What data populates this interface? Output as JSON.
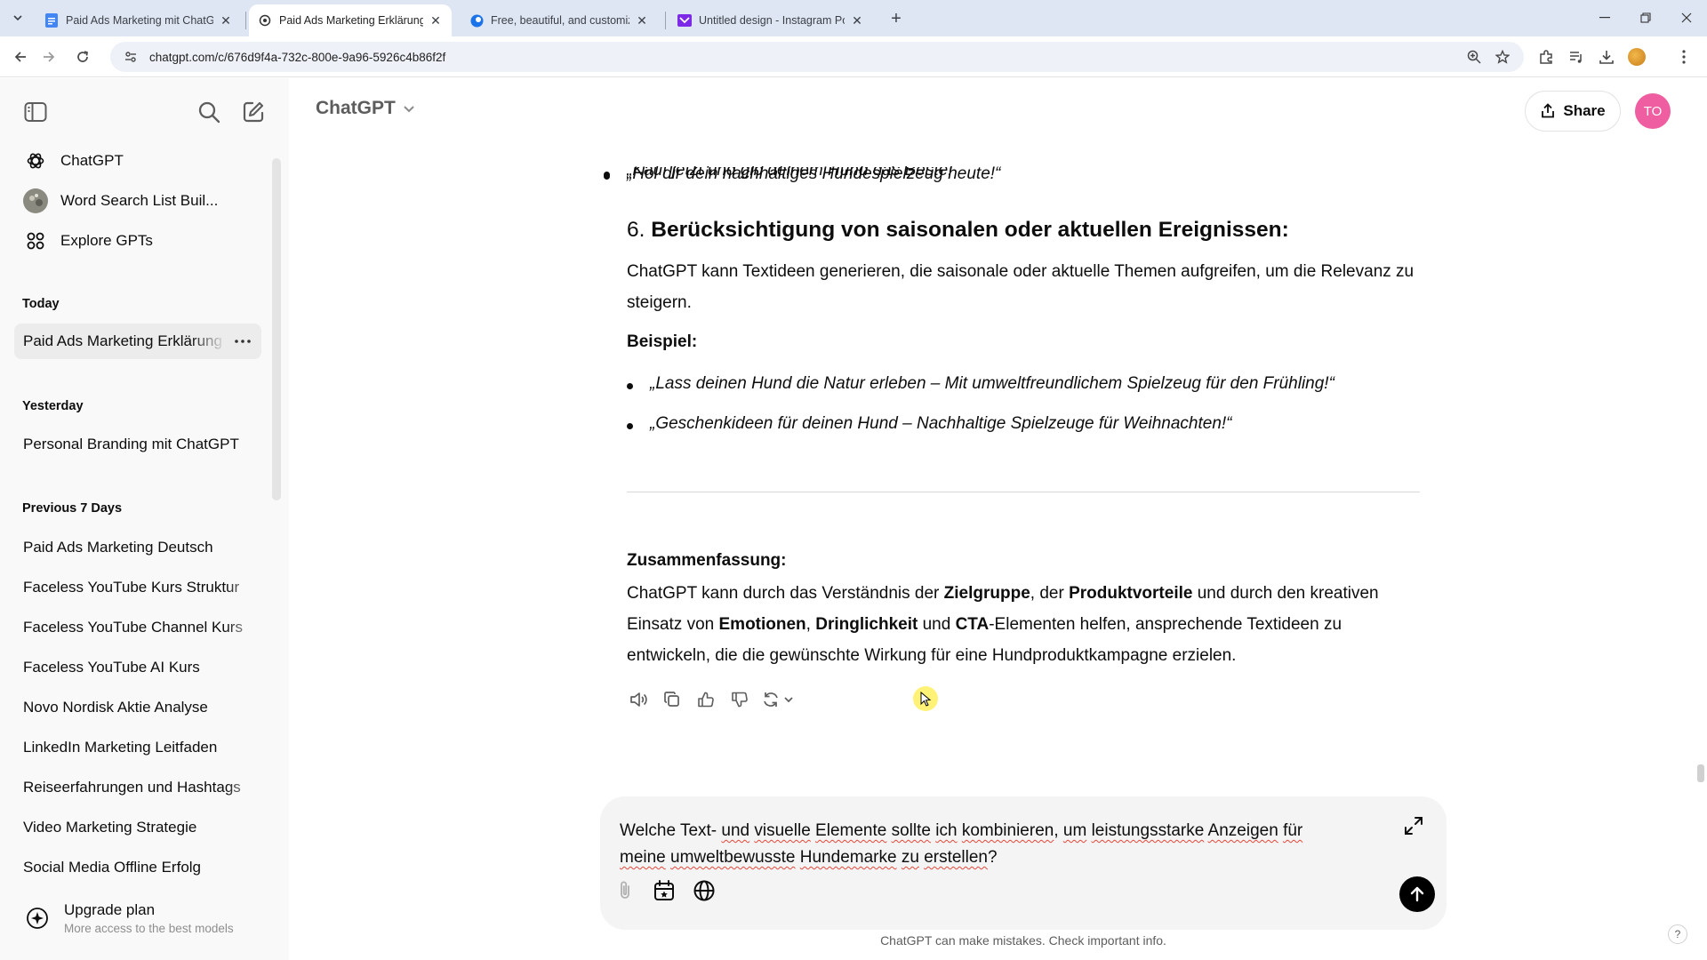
{
  "browser": {
    "tabs": [
      {
        "title": "Paid Ads Marketing mit ChatGPT",
        "active": false
      },
      {
        "title": "Paid Ads Marketing Erklärung",
        "active": true
      },
      {
        "title": "Free, beautiful, and customizable",
        "active": false
      },
      {
        "title": "Untitled design - Instagram Post",
        "active": false
      }
    ],
    "url": "chatgpt.com/c/676d9f4a-732c-800e-9a96-5926c4b86f2f"
  },
  "sidebar": {
    "nav": [
      {
        "label": "ChatGPT",
        "icon": "openai-logo-icon"
      },
      {
        "label": "Word Search List Buil...",
        "icon": "gpt-avatar-icon"
      },
      {
        "label": "Explore GPTs",
        "icon": "grid-icon"
      }
    ],
    "sections": [
      {
        "title": "Today",
        "items": [
          "Paid Ads Marketing Erklärung"
        ]
      },
      {
        "title": "Yesterday",
        "items": [
          "Personal Branding mit ChatGPT"
        ]
      },
      {
        "title": "Previous 7 Days",
        "items": [
          "Paid Ads Marketing Deutsch",
          "Faceless YouTube Kurs Struktur",
          "Faceless YouTube Channel Kurs",
          "Faceless YouTube AI Kurs",
          "Novo Nordisk Aktie Analyse",
          "LinkedIn Marketing Leitfaden",
          "Reiseerfahrungen und Hashtags",
          "Video Marketing Strategie",
          "Social Media Offline Erfolg"
        ]
      }
    ],
    "upgrade": {
      "title": "Upgrade plan",
      "subtitle": "More access to the best models"
    }
  },
  "header": {
    "model": "ChatGPT",
    "share_label": "Share",
    "avatar_initials": "TO"
  },
  "message": {
    "clipped_line": "„Kauf jetzt und gib deinem Hund das Beste!“",
    "bullet_top": "„Hol dir dein nachhaltiges Hundespielzeug heute!“",
    "heading_num": "6.",
    "heading_text": "Berücksichtigung von saisonalen oder aktuellen Ereignissen:",
    "para1": "ChatGPT kann Textideen generieren, die saisonale oder aktuelle Themen aufgreifen, um die Relevanz zu steigern.",
    "example_label": "Beispiel:",
    "examples": [
      "„Lass deinen Hund die Natur erleben – Mit umweltfreundlichem Spielzeug für den Frühling!“",
      "„Geschenkideen für deinen Hund – Nachhaltige Spielzeuge für Weihnachten!“"
    ],
    "summary_label": "Zusammenfassung:",
    "summary": {
      "p1": "ChatGPT kann durch das Verständnis der ",
      "b1": "Zielgruppe",
      "p2": ", der ",
      "b2": "Produktvorteile",
      "p3": " und durch den kreativen Einsatz von ",
      "b3": "Emotionen",
      "p4": ", ",
      "b4": "Dringlichkeit",
      "p5": " und ",
      "b5": "CTA",
      "p6": "-Elementen helfen, ansprechende Textideen zu entwickeln, die die gewünschte Wirkung für eine Hundproduktkampagne erzielen."
    }
  },
  "composer": {
    "t1": "Welche Text- ",
    "s1": "und",
    "t2": " ",
    "s2": "visuelle",
    "t3": " ",
    "s3": "Elemente",
    "t4": " ",
    "s4": "sollte",
    "t5": " ",
    "s5": "ich",
    "t6": " ",
    "s6": "kombinieren",
    "t7": ", ",
    "s7": "um",
    "t8": " ",
    "s8": "leistungsstarke",
    "t9": " ",
    "s9": "Anzeigen",
    "t10": " ",
    "s10": "für",
    "t11": " ",
    "s11": "meine",
    "t12": " ",
    "s12": "umweltbewusste",
    "t13": " ",
    "s13": "Hundemarke",
    "t14": " ",
    "s14": "zu",
    "t15": " ",
    "s15": "erstellen",
    "t16": "?"
  },
  "footer": {
    "disclaimer": "ChatGPT can make mistakes. Check important info.",
    "help": "?"
  }
}
